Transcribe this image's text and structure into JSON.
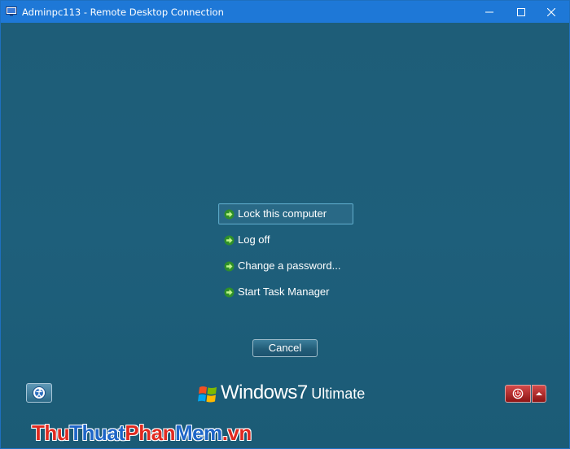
{
  "window": {
    "title": "Adminpc113 - Remote Desktop Connection",
    "controls": [
      "minimize-icon",
      "maximize-icon",
      "close-icon"
    ]
  },
  "options": [
    {
      "label": "Lock this computer",
      "selected": true
    },
    {
      "label": "Log off",
      "selected": false
    },
    {
      "label": "Change a password...",
      "selected": false
    },
    {
      "label": "Start Task Manager",
      "selected": false
    }
  ],
  "cancel_label": "Cancel",
  "brand": {
    "windows": "Windows",
    "version": "7",
    "edition": "Ultimate"
  },
  "watermark": {
    "part1": "Thu",
    "part2": "Thuat",
    "part3": "Phan",
    "part4": "Mem",
    "part5": ".vn"
  },
  "colors": {
    "titlebar": "#1e78d7",
    "background": "#1f5f7a",
    "arrow_green": "#5ad62f",
    "power_red": "#c02828"
  }
}
